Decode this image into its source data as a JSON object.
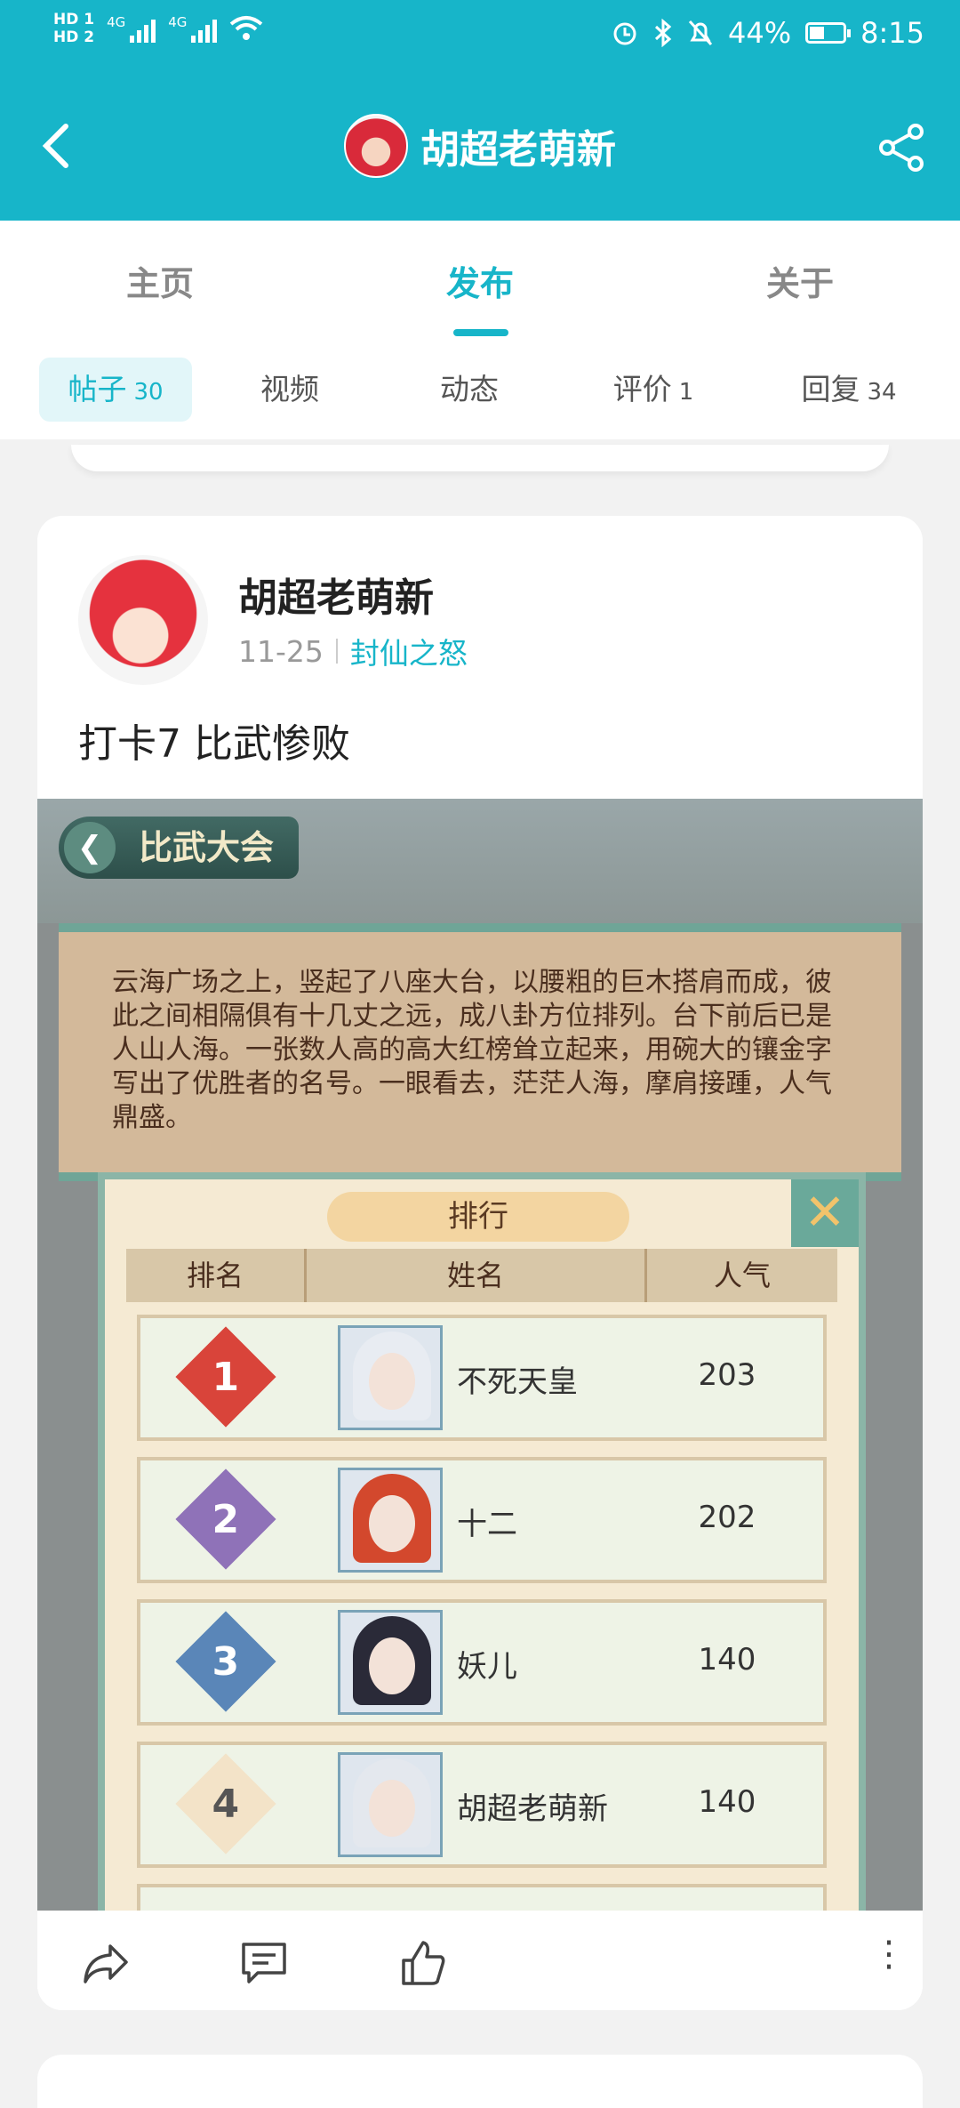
{
  "status": {
    "left_badges": [
      "HD 1",
      "HD 2"
    ],
    "net_left": "4G",
    "net_right": "4G",
    "battery": "44%",
    "battery_level": 0.44,
    "time": "8:15"
  },
  "appbar": {
    "title": "胡超老萌新"
  },
  "tabs": [
    {
      "label": "主页"
    },
    {
      "label": "发布"
    },
    {
      "label": "关于"
    }
  ],
  "subtabs": [
    {
      "label": "帖子",
      "count": "30"
    },
    {
      "label": "视频",
      "count": ""
    },
    {
      "label": "动态",
      "count": ""
    },
    {
      "label": "评价",
      "count": "1"
    },
    {
      "label": "回复",
      "count": "34"
    }
  ],
  "post": {
    "author": "胡超老萌新",
    "date": "11-25",
    "game": "封仙之怒",
    "text": "打卡7 比武惨败"
  },
  "screenshot": {
    "header": "比武大会",
    "story": "云海广场之上，竖起了八座大台，以腰粗的巨木搭肩而成，彼此之间相隔俱有十几丈之远，成八卦方位排列。台下前后已是人山人海。一张数人高的高大红榜耸立起来，用碗大的镶金字写出了优胜者的名号。一眼看去，茫茫人海，摩肩接踵，人气鼎盛。",
    "panel_title": "排行",
    "columns": [
      "排名",
      "姓名",
      "人气"
    ],
    "rows": [
      {
        "rank": "1",
        "name": "不死天皇",
        "popularity": "203",
        "badge_color": "#d9443a"
      },
      {
        "rank": "2",
        "name": "十二",
        "popularity": "202",
        "badge_color": "#8f72b8"
      },
      {
        "rank": "3",
        "name": "妖儿",
        "popularity": "140",
        "badge_color": "#5a86b8"
      },
      {
        "rank": "4",
        "name": "胡超老萌新",
        "popularity": "140",
        "badge_color": "#f3e3c8"
      }
    ]
  },
  "colors": {
    "accent": "#17b5c9"
  }
}
